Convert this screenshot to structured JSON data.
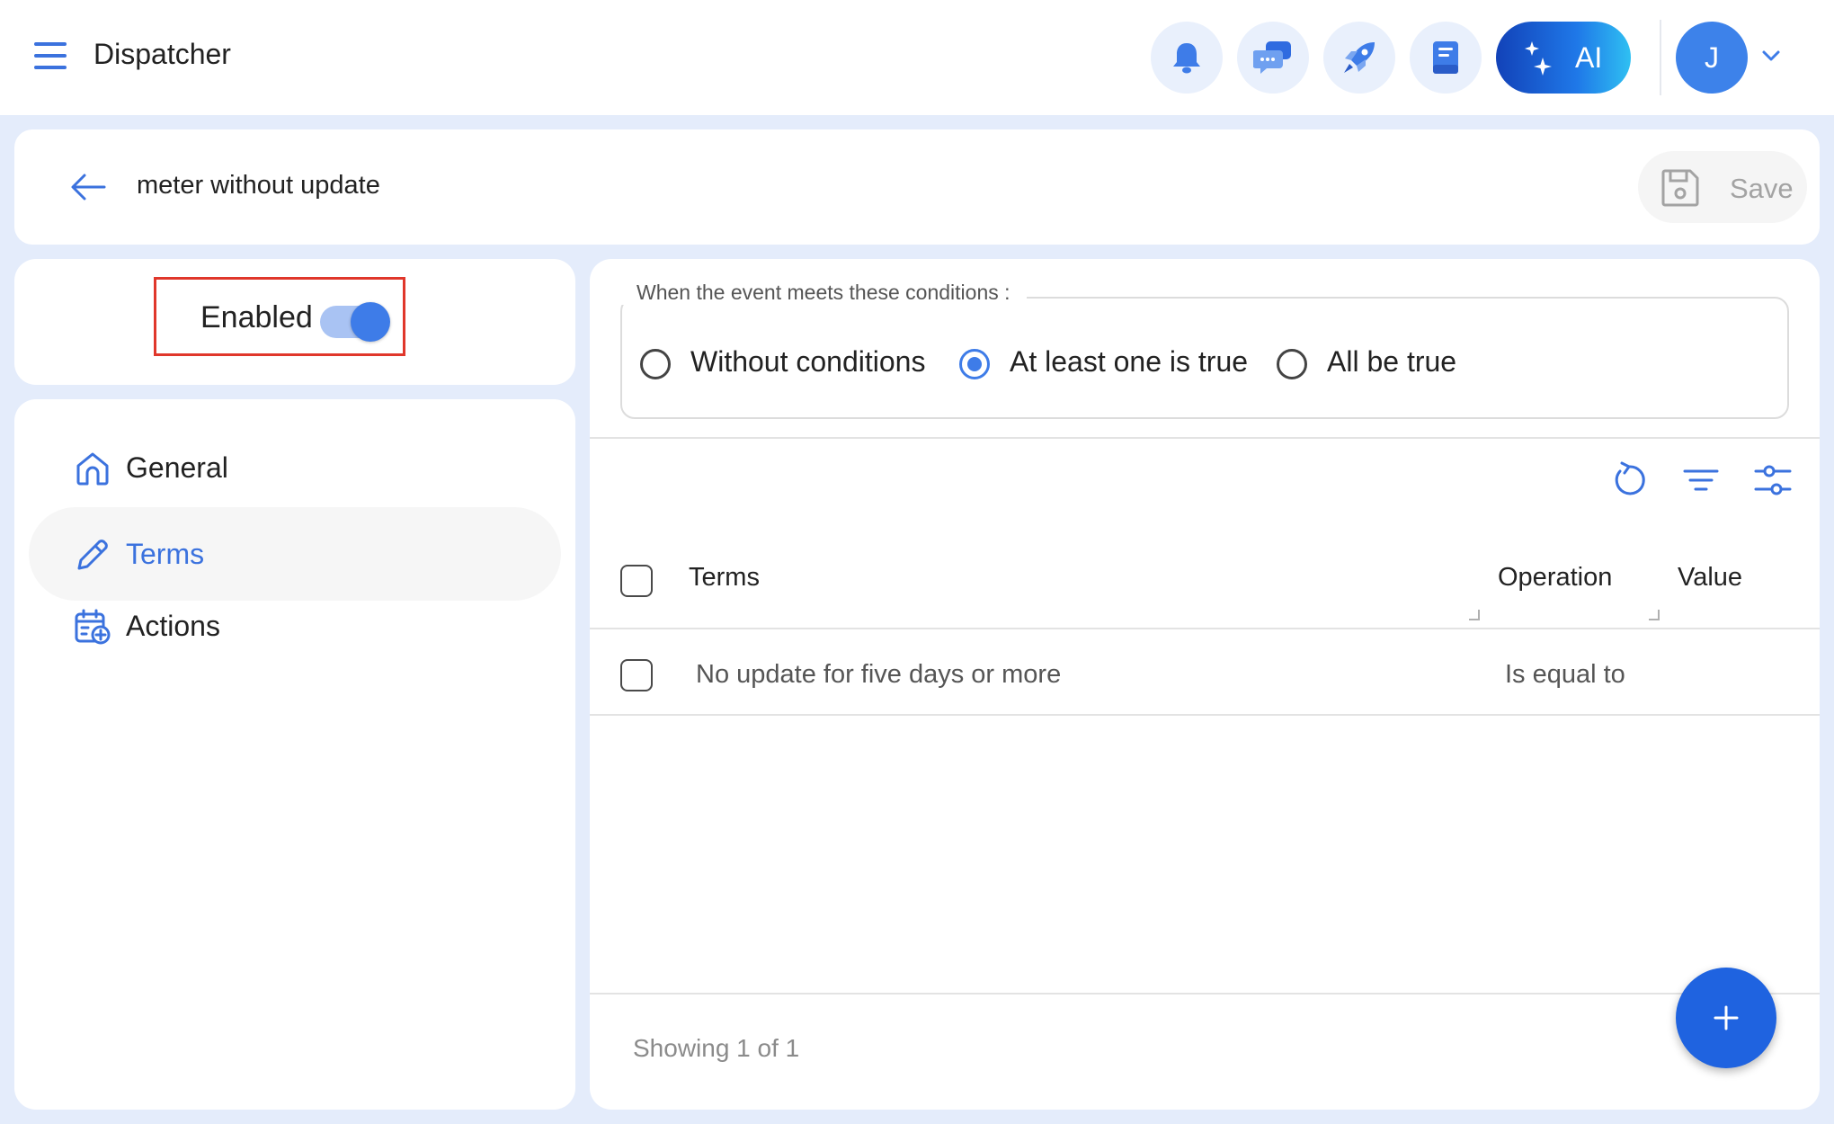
{
  "header": {
    "app_title": "Dispatcher",
    "icons": [
      "menu-icon",
      "bell-icon",
      "chat-icon",
      "rocket-icon",
      "book-icon",
      "sparkle-icon",
      "chevron-down-icon"
    ],
    "ai_label": "AI",
    "avatar_initial": "J"
  },
  "page": {
    "title": "meter without update",
    "save_label": "Save"
  },
  "status": {
    "enabled_label": "Enabled",
    "enabled": true
  },
  "nav": {
    "items": [
      {
        "label": "General",
        "icon": "home-icon",
        "active": false
      },
      {
        "label": "Terms",
        "icon": "pencil-icon",
        "active": true
      },
      {
        "label": "Actions",
        "icon": "calendar-add-icon",
        "active": false
      }
    ]
  },
  "conditions": {
    "legend": "When the event meets these conditions :",
    "options": [
      {
        "label": "Without conditions",
        "checked": false
      },
      {
        "label": "At least one is true",
        "checked": true
      },
      {
        "label": "All be true",
        "checked": false
      }
    ]
  },
  "table": {
    "toolbar_icons": [
      "refresh-icon",
      "filter-icon",
      "column-settings-icon"
    ],
    "columns": [
      "Terms",
      "Operation",
      "Value"
    ],
    "rows": [
      {
        "term": "No update for five days or more",
        "operation": "Is equal to",
        "value": ""
      }
    ],
    "footer": "Showing 1 of 1"
  },
  "fab": {
    "icon": "plus-icon"
  },
  "colors": {
    "accent": "#3e7ce8",
    "fab": "#1f63e0",
    "page_bg": "#e4ecfb",
    "highlight_box": "#e0372b"
  }
}
